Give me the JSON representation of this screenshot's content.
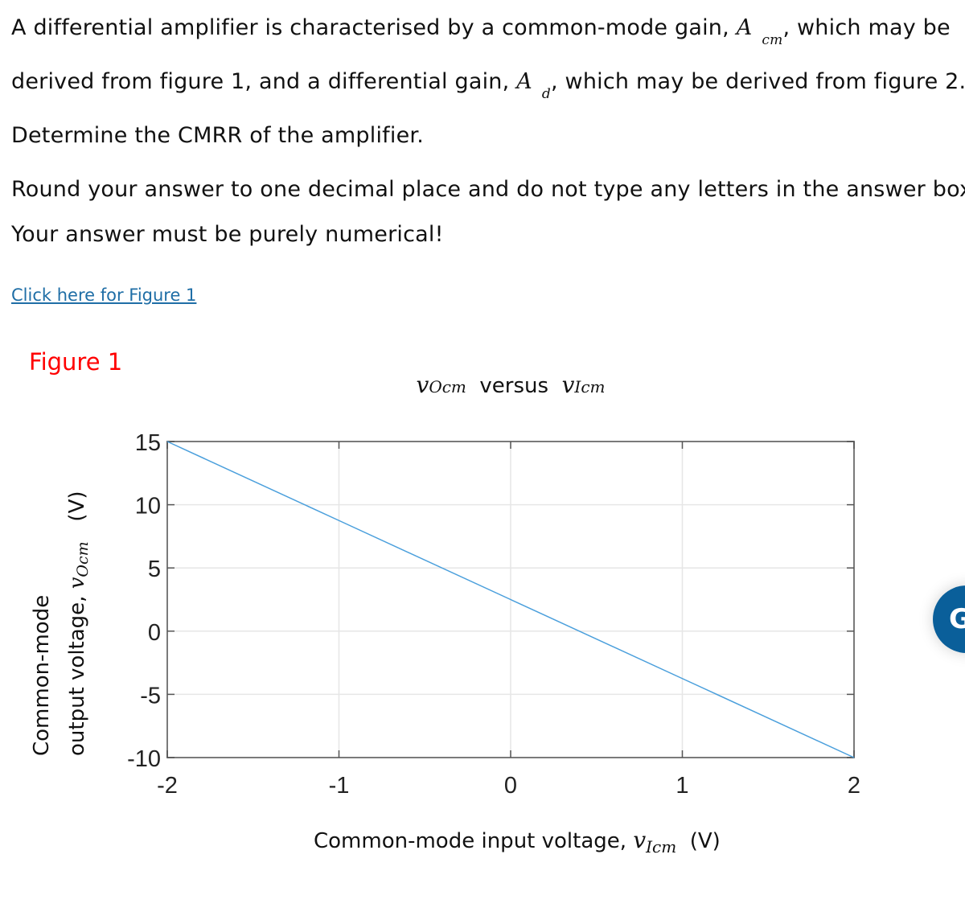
{
  "question": {
    "line1_pre": "A differential amplifier is characterised by a common-mode gain,",
    "acm_symbol": "A",
    "acm_sub": "cm",
    "line1_post": ", which may be",
    "line2_pre": "derived from figure 1, and a differential gain,",
    "ad_symbol": "A",
    "ad_sub": "d",
    "line2_post": ", which may be derived from figure 2.",
    "line3": "Determine the CMRR of the amplifier.",
    "instruction_line1": "Round your answer to one decimal place and do not type any letters in the answer box.",
    "instruction_line2": "Your answer must be purely numerical!"
  },
  "figure_link": "Click here for Figure 1",
  "figure_heading": "Figure 1",
  "fab_icon": "G",
  "colors": {
    "line": "#4a9fdc",
    "link": "#1f6ea6",
    "figure_heading": "#ff0000",
    "fab": "#0a5f9a"
  },
  "chart_data": {
    "type": "line",
    "title": {
      "left_var": "v",
      "left_sub": "Ocm",
      "middle": "versus",
      "right_var": "v",
      "right_sub": "Icm"
    },
    "xlabel": {
      "text": "Common-mode input voltage,",
      "var": "v",
      "sub": "Icm",
      "unit": "(V)"
    },
    "ylabel": {
      "line1": "Common-mode",
      "line2_text": "output voltage,",
      "var": "v",
      "sub": "Ocm",
      "unit": "(V)"
    },
    "xlim": [
      -2,
      2
    ],
    "ylim": [
      -10,
      15
    ],
    "xticks": [
      -2,
      -1,
      0,
      1,
      2
    ],
    "yticks": [
      15,
      10,
      5,
      0,
      -5,
      -10
    ],
    "grid": true,
    "series": [
      {
        "name": "vOcm",
        "x": [
          -2,
          -1,
          0,
          1,
          2
        ],
        "y": [
          15,
          8.75,
          2.5,
          -3.75,
          -10
        ]
      }
    ]
  }
}
